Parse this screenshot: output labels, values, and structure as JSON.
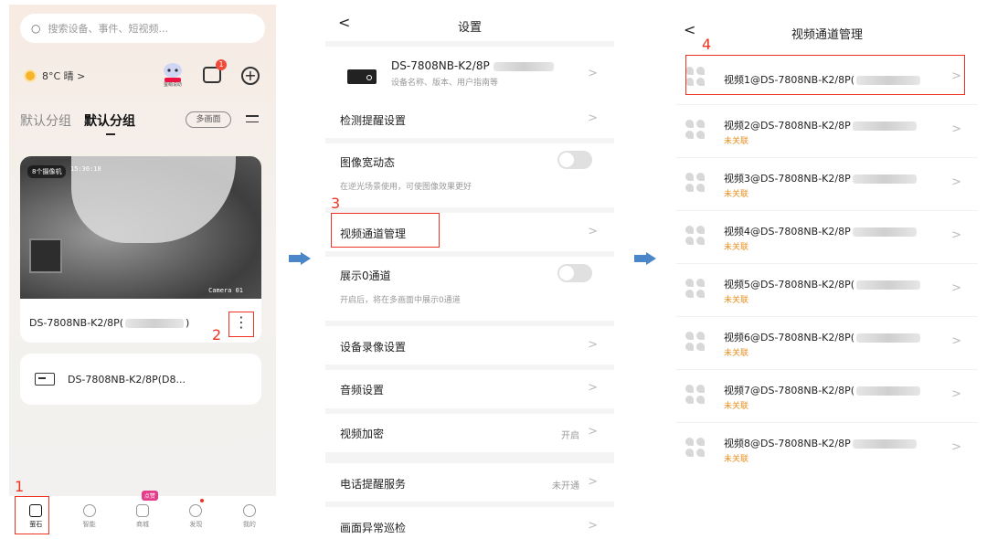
{
  "p1": {
    "search_placeholder": "搜索设备、事件、短视频...",
    "weather": "8°C 晴 >",
    "robot_label": "萤萌说助",
    "msg_badge": "1",
    "group_default": "默认分组",
    "group_active": "默认分组",
    "multi_screen": "多画面",
    "cam_tag": "8个摄像机",
    "cam_time": "15:36:18",
    "cam_label": "Camera 01",
    "device_name_prefix": "DS-7808NB-K2/8P(",
    "device_name_suffix": ")",
    "more_dots": "⋮",
    "device2_name": "DS-7808NB-K2/8P(D8...",
    "tabs": [
      {
        "label": "萤石"
      },
      {
        "label": "智能"
      },
      {
        "label": "商城",
        "hot": "点赞"
      },
      {
        "label": "发现"
      },
      {
        "label": "我的"
      }
    ],
    "step1": "1",
    "step2": "2"
  },
  "p2": {
    "back": "<",
    "title": "设置",
    "device_model": "DS-7808NB-K2/8P",
    "device_desc": "设备名称、版本、用户指南等",
    "chevron": ">",
    "detect": "检测提醒设置",
    "wdr": "图像宽动态",
    "wdr_desc": "在逆光场景使用，可使图像效果更好",
    "channel_mgmt": "视频通道管理",
    "show_zero": "展示0通道",
    "show_zero_desc": "开启后，将在多画面中展示0通道",
    "record": "设备录像设置",
    "audio": "音频设置",
    "encrypt": "视频加密",
    "encrypt_val": "开启",
    "phone_alert": "电话提醒服务",
    "phone_val": "未开通",
    "patrol": "画面异常巡检",
    "step3": "3"
  },
  "p3": {
    "back": "<",
    "title": "视频通道管理",
    "step4": "4",
    "chevron": ">",
    "channels": [
      {
        "name": "视频1@DS-7808NB-K2/8P(",
        "status": ""
      },
      {
        "name": "视频2@DS-7808NB-K2/8P",
        "status": "未关联"
      },
      {
        "name": "视频3@DS-7808NB-K2/8P",
        "status": "未关联"
      },
      {
        "name": "视频4@DS-7808NB-K2/8P",
        "status": "未关联"
      },
      {
        "name": "视频5@DS-7808NB-K2/8P(",
        "status": "未关联"
      },
      {
        "name": "视频6@DS-7808NB-K2/8P(",
        "status": "未关联"
      },
      {
        "name": "视频7@DS-7808NB-K2/8P(",
        "status": "未关联"
      },
      {
        "name": "视频8@DS-7808NB-K2/8P",
        "status": "未关联"
      }
    ]
  },
  "colors": {
    "highlight": "#ee3322",
    "arrow": "#4a86c8",
    "status": "#e89020"
  }
}
